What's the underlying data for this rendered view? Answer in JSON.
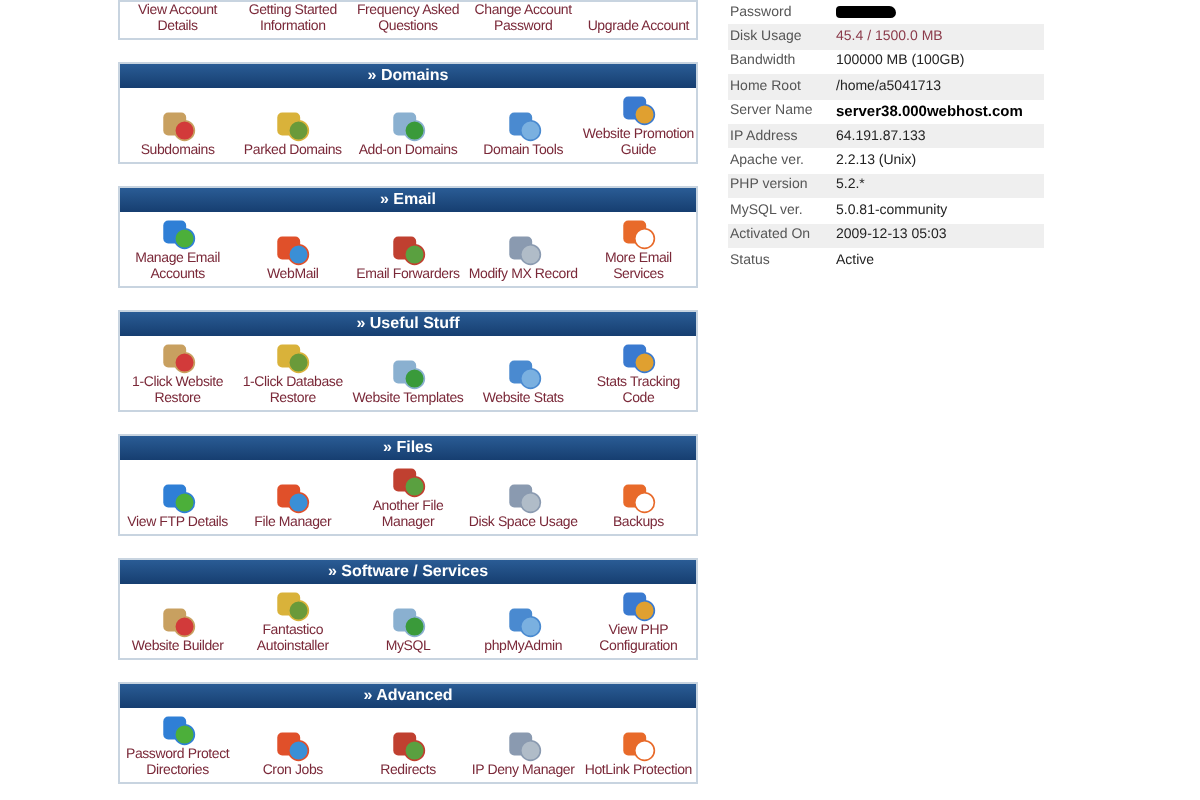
{
  "sections": [
    {
      "kind": "partial",
      "items": [
        "View Account Details",
        "Getting Started Information",
        "Frequency Asked Questions",
        "Change Account Password",
        "Upgrade Account"
      ]
    },
    {
      "kind": "full",
      "title": "» Domains",
      "items": [
        "Subdomains",
        "Parked Domains",
        "Add-on Domains",
        "Domain Tools",
        "Website Promotion Guide"
      ]
    },
    {
      "kind": "full",
      "title": "» Email",
      "items": [
        "Manage Email Accounts",
        "WebMail",
        "Email Forwarders",
        "Modify MX Record",
        "More Email Services"
      ]
    },
    {
      "kind": "full",
      "title": "» Useful Stuff",
      "items": [
        "1-Click Website Restore",
        "1-Click Database Restore",
        "Website Templates",
        "Website Stats",
        "Stats Tracking Code"
      ]
    },
    {
      "kind": "full",
      "title": "» Files",
      "items": [
        "View FTP Details",
        "File Manager",
        "Another File Manager",
        "Disk Space Usage",
        "Backups"
      ]
    },
    {
      "kind": "full",
      "title": "» Software / Services",
      "items": [
        "Website Builder",
        "Fantastico Autoinstaller",
        "MySQL",
        "phpMyAdmin",
        "View PHP Configuration"
      ]
    },
    {
      "kind": "full",
      "title": "» Advanced",
      "items": [
        "Password Protect Directories",
        "Cron Jobs",
        "Redirects",
        "IP Deny Manager",
        "HotLink Protection"
      ]
    }
  ],
  "account_info": [
    {
      "label": "Password",
      "kind": "redacted"
    },
    {
      "label": "Disk Usage",
      "value": "45.4 / 1500.0 MB",
      "kind": "usage"
    },
    {
      "label": "Bandwidth",
      "value": "100000 MB (100GB)",
      "kind": "plain"
    },
    {
      "label": "Home Root",
      "value": "/home/a5041713",
      "kind": "plain"
    },
    {
      "label": "Server Name",
      "value": "server38.000webhost.com",
      "kind": "bold"
    },
    {
      "label": "IP Address",
      "value": "64.191.87.133",
      "kind": "plain"
    },
    {
      "label": "Apache ver.",
      "value": "2.2.13 (Unix)",
      "kind": "plain"
    },
    {
      "label": "PHP version",
      "value": "5.2.*",
      "kind": "plain"
    },
    {
      "label": "MySQL ver.",
      "value": "5.0.81-community",
      "kind": "plain"
    },
    {
      "label": "Activated On",
      "value": "2009-12-13 05:03",
      "kind": "plain"
    },
    {
      "label": "Status",
      "value": "Active",
      "kind": "plain"
    }
  ]
}
